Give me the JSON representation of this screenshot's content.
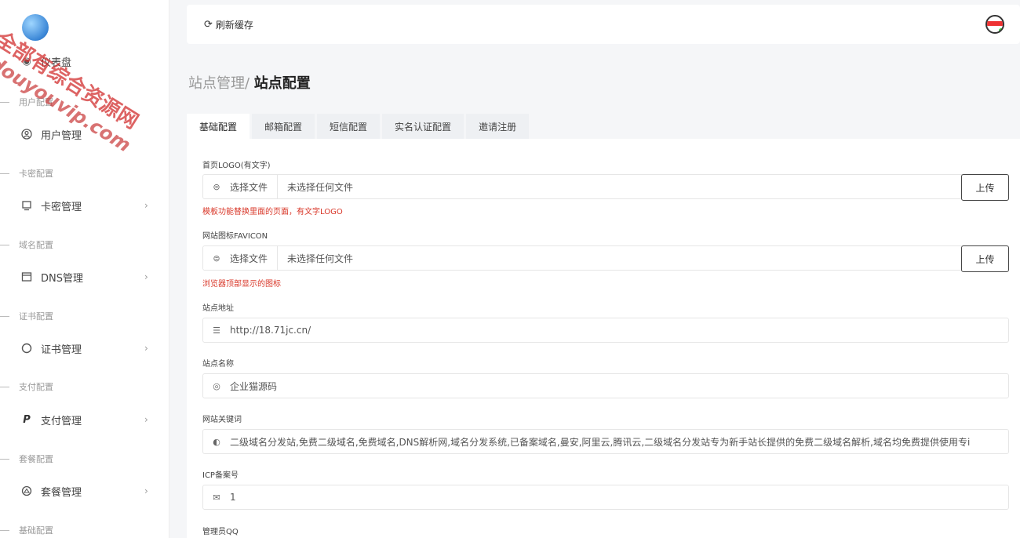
{
  "watermark": {
    "line1": "全部有综合资源网",
    "line2": "douyouvip.com"
  },
  "sidebar": {
    "items": [
      {
        "type": "item",
        "label": "仪表盘",
        "icon": "eye-icon",
        "chevron": false
      },
      {
        "type": "group",
        "label": "用户配置"
      },
      {
        "type": "item",
        "label": "用户管理",
        "icon": "user-circle-icon",
        "chevron": false
      },
      {
        "type": "group",
        "label": "卡密配置"
      },
      {
        "type": "item",
        "label": "卡密管理",
        "icon": "monitor-icon",
        "chevron": true
      },
      {
        "type": "group",
        "label": "域名配置"
      },
      {
        "type": "item",
        "label": "DNS管理",
        "icon": "window-icon",
        "chevron": true
      },
      {
        "type": "group",
        "label": "证书配置"
      },
      {
        "type": "item",
        "label": "证书管理",
        "icon": "circle-icon",
        "chevron": true
      },
      {
        "type": "group",
        "label": "支付配置"
      },
      {
        "type": "item",
        "label": "支付管理",
        "icon": "paypal-icon",
        "chevron": true
      },
      {
        "type": "group",
        "label": "套餐配置"
      },
      {
        "type": "item",
        "label": "套餐管理",
        "icon": "package-icon",
        "chevron": true
      },
      {
        "type": "group",
        "label": "基础配置"
      }
    ]
  },
  "header": {
    "refresh_label": "刷新缓存"
  },
  "breadcrumb": {
    "parent": "站点管理/ ",
    "current": "站点配置"
  },
  "tabs": [
    "基础配置",
    "邮箱配置",
    "短信配置",
    "实名认证配置",
    "邀请注册"
  ],
  "form": {
    "logo": {
      "label": "首页LOGO(有文字)",
      "choose": "选择文件",
      "file": "未选择任何文件",
      "upload": "上传",
      "hint": "模板功能替换里面的页面，有文字LOGO"
    },
    "favicon": {
      "label": "网站图标FAVICON",
      "choose": "选择文件",
      "file": "未选择任何文件",
      "upload": "上传",
      "hint": "浏览器顶部显示的图标"
    },
    "site_url": {
      "label": "站点地址",
      "value": "http://18.71jc.cn/"
    },
    "site_name": {
      "label": "站点名称",
      "value": "企业猫源码"
    },
    "keywords": {
      "label": "网站关键词",
      "value": "二级域名分发站,免费二级域名,免费域名,DNS解析网,域名分发系统,已备案域名,曼安,阿里云,腾讯云,二级域名分发站专为新手站长提供的免费二级域名解析,域名均免费提供使用专i"
    },
    "icp": {
      "label": "ICP备案号",
      "value": "1"
    },
    "admin_qq": {
      "label": "管理员QQ"
    }
  }
}
